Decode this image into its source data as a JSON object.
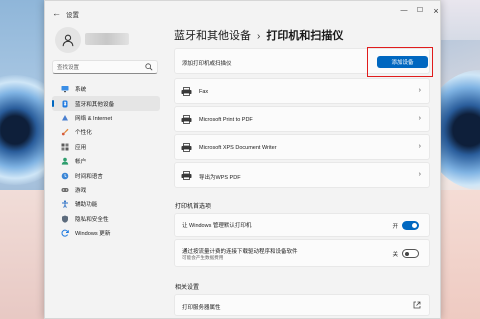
{
  "window": {
    "title": "设置",
    "controls": {
      "minimize": "—",
      "maximize": "☐",
      "close": "×"
    }
  },
  "search": {
    "placeholder": "查找设置"
  },
  "sidebar": {
    "items": [
      {
        "label": "系统",
        "icon": "monitor-icon",
        "active": false
      },
      {
        "label": "蓝牙和其他设备",
        "icon": "bluetooth-icon",
        "active": true
      },
      {
        "label": "网络 & Internet",
        "icon": "wifi-icon",
        "active": false
      },
      {
        "label": "个性化",
        "icon": "brush-icon",
        "active": false
      },
      {
        "label": "应用",
        "icon": "apps-icon",
        "active": false
      },
      {
        "label": "帐户",
        "icon": "person-icon",
        "active": false
      },
      {
        "label": "时间和语言",
        "icon": "globe-clock-icon",
        "active": false
      },
      {
        "label": "游戏",
        "icon": "gamepad-icon",
        "active": false
      },
      {
        "label": "辅助功能",
        "icon": "accessibility-icon",
        "active": false
      },
      {
        "label": "隐私和安全性",
        "icon": "shield-icon",
        "active": false
      },
      {
        "label": "Windows 更新",
        "icon": "update-icon",
        "active": false
      }
    ]
  },
  "breadcrumb": {
    "parent": "蓝牙和其他设备",
    "separator": "›",
    "current": "打印机和扫描仪"
  },
  "add_device": {
    "label": "添加打印机或扫描仪",
    "button": "添加设备"
  },
  "printers": [
    {
      "name": "Fax"
    },
    {
      "name": "Microsoft Print to PDF"
    },
    {
      "name": "Microsoft XPS Document Writer"
    },
    {
      "name": "导出为WPS PDF"
    }
  ],
  "printer_prefs": {
    "heading": "打印机首选项",
    "default_printer": {
      "label": "让 Windows 管理默认打印机",
      "state": "开",
      "on": true
    },
    "metered": {
      "label": "通过按流量计费的连接下载驱动程序和设备软件",
      "sub": "可能会产生数据费用",
      "state": "关",
      "on": false
    }
  },
  "related": {
    "heading": "相关设置",
    "print_server": "打印服务器属性"
  },
  "colors": {
    "accent": "#0067c0",
    "highlight": "#e01c1c"
  }
}
